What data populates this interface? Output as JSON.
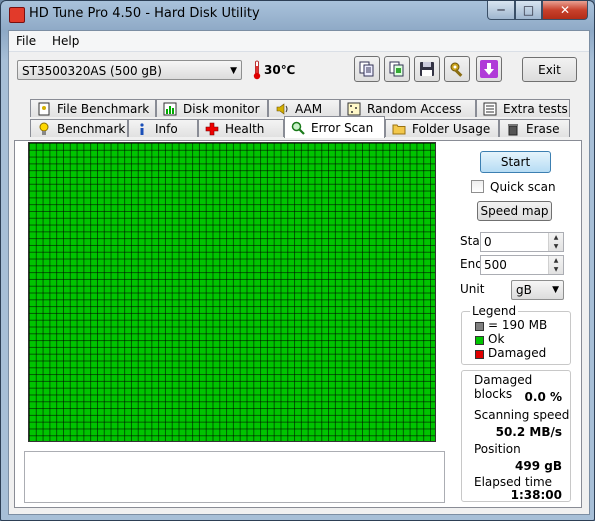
{
  "window": {
    "title": "HD Tune Pro 4.50 - Hard Disk Utility"
  },
  "menu": {
    "file": "File",
    "help": "Help"
  },
  "toolbar": {
    "drive": "ST3500320AS (500 gB)",
    "temperature": "30℃",
    "exit": "Exit"
  },
  "tabs_top": [
    "File Benchmark",
    "Disk monitor",
    "AAM",
    "Random Access",
    "Extra tests"
  ],
  "tabs_bottom": [
    "Benchmark",
    "Info",
    "Health",
    "Error Scan",
    "Folder Usage",
    "Erase"
  ],
  "active_tab": "Error Scan",
  "scan": {
    "start_button": "Start",
    "quick_scan": "Quick scan",
    "quick_scan_checked": false,
    "speed_map_button": "Speed map",
    "start_label": "Start",
    "start_value": "0",
    "end_label": "End",
    "end_value": "500",
    "unit_label": "Unit",
    "unit_value": "gB"
  },
  "legend": {
    "title": "Legend",
    "block": "= 190 MB",
    "ok": "Ok",
    "damaged": "Damaged",
    "colors": {
      "block": "#808080",
      "ok": "#00c400",
      "damaged": "#e00000"
    }
  },
  "stats": {
    "damaged_label": "Damaged blocks",
    "damaged_value": "0.0 %",
    "speed_label": "Scanning speed",
    "speed_value": "50.2 MB/s",
    "position_label": "Position",
    "position_value": "499 gB",
    "elapsed_label": "Elapsed time",
    "elapsed_value": "1:38:00"
  }
}
